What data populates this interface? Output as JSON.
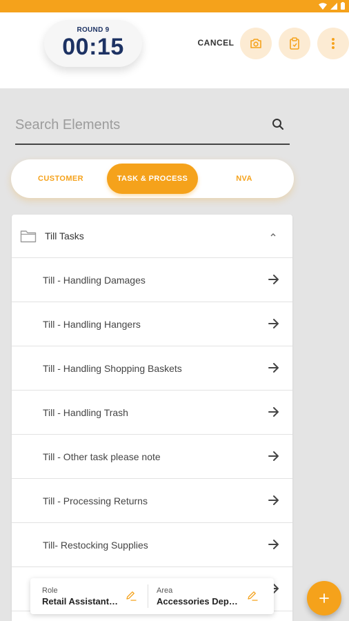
{
  "colors": {
    "accent": "#f5a21b",
    "timer_text": "#1d3263"
  },
  "timer": {
    "round": "ROUND 9",
    "time": "00:15"
  },
  "actions": {
    "cancel": "CANCEL",
    "camera_icon": "camera-icon",
    "clipboard_icon": "clipboard-icon",
    "more_icon": "more-vert-icon"
  },
  "search": {
    "placeholder": "Search Elements",
    "value": ""
  },
  "tabs": [
    {
      "label": "CUSTOMER",
      "active": false
    },
    {
      "label": "TASK & PROCESS",
      "active": true
    },
    {
      "label": "NVA",
      "active": false
    }
  ],
  "group": {
    "title": "Till Tasks",
    "expanded": true
  },
  "items": [
    {
      "label": "Till - Handling Damages"
    },
    {
      "label": "Till - Handling Hangers"
    },
    {
      "label": "Till - Handling Shopping Baskets"
    },
    {
      "label": "Till - Handling Trash"
    },
    {
      "label": "Till - Other task please note"
    },
    {
      "label": "Till - Processing Returns"
    },
    {
      "label": "Till- Restocking Supplies"
    }
  ],
  "info": {
    "role_caption": "Role",
    "role_value": "Retail Assistant…",
    "area_caption": "Area",
    "area_value": "Accessories Depa…"
  },
  "fab": {
    "icon": "plus-icon"
  }
}
